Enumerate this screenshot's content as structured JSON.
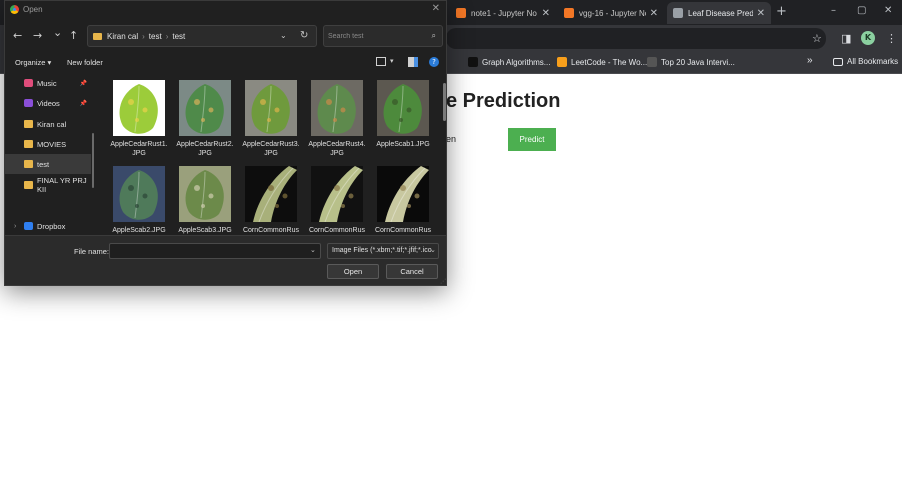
{
  "browser": {
    "tabs": [
      {
        "title": "note1 - Jupyter No",
        "active": false,
        "fav": "#f37726"
      },
      {
        "title": "vgg-16 - Jupyter No",
        "active": false,
        "fav": "#f37726"
      },
      {
        "title": "Leaf Disease Predict",
        "active": true,
        "fav": "#9aa0a6"
      }
    ],
    "new_tab": "+",
    "window_controls": {
      "minimize": "–",
      "maximize": "▢",
      "close": "✕"
    },
    "toolbar": {
      "star_icon": "☆",
      "sidebar_icon": "◨",
      "profile_initial": "K",
      "menu_icon": "⋮"
    },
    "bookmarks": [
      {
        "label": "Graph Algorithms...",
        "color": "#111111"
      },
      {
        "label": "LeetCode - The Wo...",
        "color": "#f89f1b"
      },
      {
        "label": "Top 20 Java Intervi...",
        "color": "#555555"
      }
    ],
    "bookmarks_overflow": "»",
    "all_bookmarks": "All Bookmarks"
  },
  "page": {
    "heading": "e Prediction",
    "file_label_fragment": "en",
    "predict_label": "Predict",
    "predict_color": "#4caf50"
  },
  "dialog": {
    "title": "Open",
    "close": "✕",
    "nav": {
      "back": "←",
      "forward": "→",
      "dropdown": "⌄",
      "up": "↑"
    },
    "address": {
      "crumbs": [
        "Kiran cal",
        "test",
        "test"
      ],
      "refresh": "↻",
      "dropdown": "⌄"
    },
    "search": {
      "placeholder": "Search test",
      "icon": "⌕"
    },
    "commands": {
      "organize": "Organize ▾",
      "new_folder": "New folder",
      "help": "?"
    },
    "nav_pane": [
      {
        "label": "Music",
        "icon": "music",
        "color": "#e04d7b",
        "pinned": true,
        "selected": false
      },
      {
        "label": "Videos",
        "icon": "video",
        "color": "#8a4fd8",
        "pinned": true,
        "selected": false
      },
      {
        "label": "Kiran cal",
        "icon": "folder",
        "color": "#e8b64b",
        "pinned": false,
        "selected": false
      },
      {
        "label": "MOVIES",
        "icon": "folder",
        "color": "#e8b64b",
        "pinned": false,
        "selected": false
      },
      {
        "label": "test",
        "icon": "folder",
        "color": "#e8b64b",
        "pinned": false,
        "selected": true
      },
      {
        "label": "FINAL YR PRJ KII",
        "icon": "folder",
        "color": "#e8b64b",
        "pinned": false,
        "selected": false
      },
      {
        "label": "Dropbox",
        "icon": "dropbox",
        "color": "#2f7ff0",
        "pinned": false,
        "selected": false
      }
    ],
    "files": [
      {
        "name": "AppleCedarRust1.JPG",
        "bg": "#ffffff",
        "leaf": "#9ccc3a",
        "spot": "#e6d24a"
      },
      {
        "name": "AppleCedarRust2.JPG",
        "bg": "#7c8a86",
        "leaf": "#4f8a4a",
        "spot": "#cfae5a"
      },
      {
        "name": "AppleCedarRust3.JPG",
        "bg": "#8a8a82",
        "leaf": "#6f9a3d",
        "spot": "#d4b24a"
      },
      {
        "name": "AppleCedarRust4.JPG",
        "bg": "#6d6a63",
        "leaf": "#5e8a4d",
        "spot": "#c48a4a"
      },
      {
        "name": "AppleScab1.JPG",
        "bg": "#5c5850",
        "leaf": "#4d8a3c",
        "spot": "#3a5a2a"
      },
      {
        "name": "AppleScab2.JPG",
        "bg": "#3a4a6a",
        "leaf": "#4f7a5a",
        "spot": "#2e4a3a"
      },
      {
        "name": "AppleScab3.JPG",
        "bg": "#9aa07c",
        "leaf": "#6c8a4a",
        "spot": "#c8c8a8"
      },
      {
        "name": "CornCommonRus",
        "bg": "#0d0d0d",
        "leaf": "#a8b07a",
        "spot": "#7a6a3a"
      },
      {
        "name": "CornCommonRus",
        "bg": "#111111",
        "leaf": "#b8c08a",
        "spot": "#8a7a4a"
      },
      {
        "name": "CornCommonRus",
        "bg": "#0a0a0a",
        "leaf": "#c8c8a0",
        "spot": "#9a8a5a"
      }
    ],
    "file_name_label": "File name:",
    "file_name_value": "",
    "file_type": "Image Files (*.xbm;*.tif;*.jfif;*.ico",
    "open_label": "Open",
    "cancel_label": "Cancel"
  }
}
